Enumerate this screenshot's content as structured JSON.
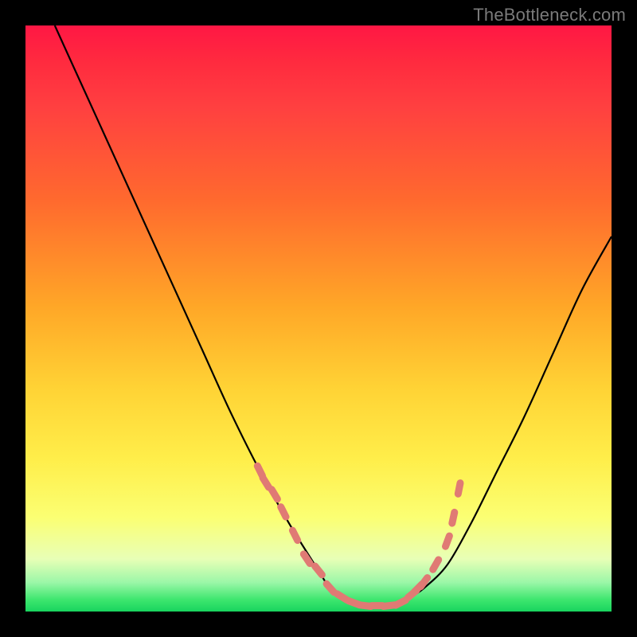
{
  "watermark": "TheBottleneck.com",
  "chart_data": {
    "type": "line",
    "title": "",
    "xlabel": "",
    "ylabel": "",
    "xlim": [
      0,
      100
    ],
    "ylim": [
      0,
      100
    ],
    "series": [
      {
        "name": "bottleneck-curve",
        "x": [
          5,
          10,
          15,
          20,
          25,
          30,
          35,
          40,
          45,
          50,
          52,
          55,
          58,
          60,
          63,
          65,
          68,
          72,
          76,
          80,
          85,
          90,
          95,
          100
        ],
        "y": [
          100,
          89,
          78,
          67,
          56,
          45,
          34,
          24,
          15,
          7,
          4,
          2,
          1,
          1,
          1,
          2,
          4,
          8,
          15,
          23,
          33,
          44,
          55,
          64
        ]
      },
      {
        "name": "highlight-dots",
        "x": [
          40,
          41,
          42.5,
          44,
          46,
          48,
          50,
          52,
          54,
          56,
          58,
          60,
          62,
          64,
          66,
          67,
          68,
          70,
          72,
          73,
          74
        ],
        "y": [
          24,
          22,
          20,
          17,
          13,
          9,
          7,
          4,
          2.5,
          1.5,
          1,
          1,
          1,
          1.5,
          3,
          4,
          5,
          8,
          12,
          16,
          21
        ]
      }
    ],
    "colors": {
      "curve": "#000000",
      "dots": "#e07a74",
      "gradient_top": "#ff1744",
      "gradient_bottom": "#18d45e"
    }
  }
}
